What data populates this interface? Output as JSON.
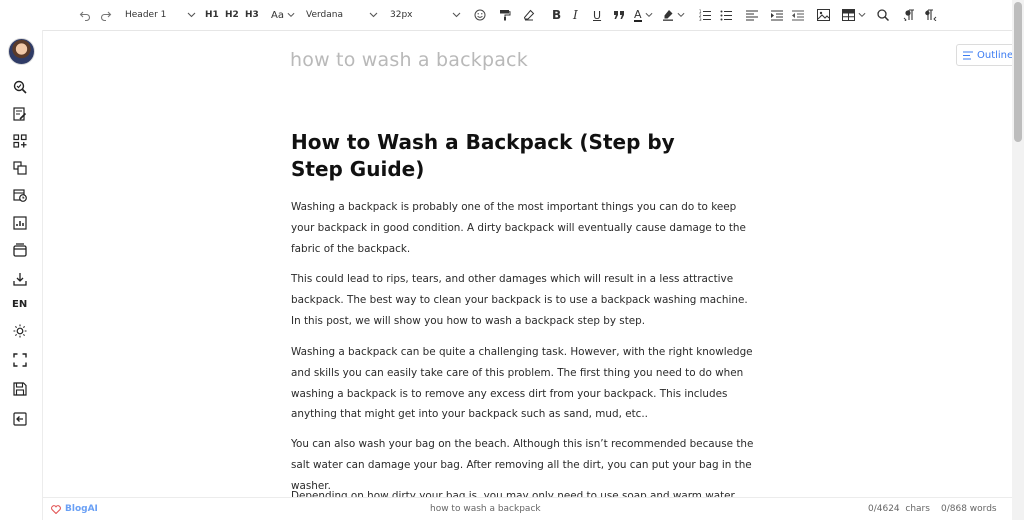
{
  "toolbar": {
    "block_format": "Header 1",
    "h1": "H1",
    "h2": "H2",
    "h3": "H3",
    "font_size_label": "Aa",
    "font_family": "Verdana",
    "font_size": "32px",
    "bold": "B",
    "italic": "I",
    "underline": "U",
    "text_color": "A",
    "icons": [
      "undo-icon",
      "redo-icon",
      "emoji-icon",
      "format-painter-icon",
      "clear-format-icon",
      "quote-icon",
      "highlight-icon",
      "ordered-list-icon",
      "bullet-list-icon",
      "align-left-icon",
      "indent-icon",
      "outdent-icon",
      "image-icon",
      "table-icon",
      "search-icon",
      "paragraph-ltr-icon",
      "paragraph-rtl-icon"
    ]
  },
  "sidebar": {
    "language": "EN",
    "icons": [
      "search-icon",
      "edit-note-icon",
      "apps-add-icon",
      "copy-icon",
      "history-icon",
      "stats-icon",
      "archive-icon",
      "download-icon",
      "theme-icon",
      "fullscreen-icon",
      "save-icon",
      "exit-icon"
    ]
  },
  "editor": {
    "title_placeholder": "how to wash a backpack",
    "outline_label": "Outline",
    "heading": "How to Wash a Backpack (Step by Step Guide)",
    "paragraphs": [
      "Washing a backpack is probably one of the most important things you can do to keep your backpack in good condition. A dirty backpack will eventually cause damage to the fabric of the backpack.",
      "This could lead to rips, tears, and other damages which will result in a less attractive backpack. The best way to clean your backpack is to use a backpack washing machine. In this post, we will show you how to wash a backpack step by step.",
      "Washing a backpack can be quite a challenging task. However, with the right knowledge and skills you can easily take care of this problem. The first thing you need to do when washing a backpack is to remove any excess dirt from your backpack. This includes anything that might get into your backpack such as sand, mud, etc..",
      "You can also wash your bag on the beach. Although this isn’t recommended because the salt water can damage your bag. After removing all the dirt, you can put your bag in the washer.",
      "Depending on how dirty your bag is, you may only need to use soap and warm water. Once"
    ]
  },
  "status": {
    "brand": "BlogAI",
    "doc_title": "how to wash a backpack",
    "chars": "0/4624  chars",
    "words": "0/868 words"
  },
  "colors": {
    "accent": "#3c7cf2",
    "brand": "#e25555"
  }
}
